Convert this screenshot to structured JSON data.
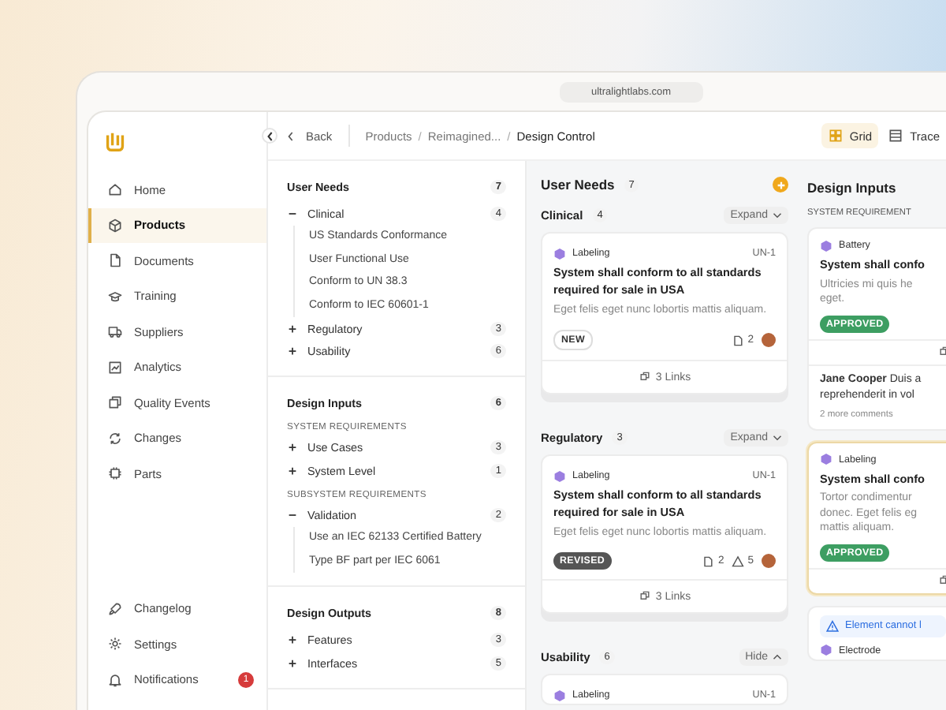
{
  "browser": {
    "url": "ultralightlabs.com"
  },
  "sidebar": {
    "items": [
      {
        "label": "Home",
        "selected": false
      },
      {
        "label": "Products",
        "selected": true
      },
      {
        "label": "Documents",
        "selected": false
      },
      {
        "label": "Training",
        "selected": false
      },
      {
        "label": "Suppliers",
        "selected": false
      },
      {
        "label": "Analytics",
        "selected": false
      },
      {
        "label": "Quality Events",
        "selected": false
      },
      {
        "label": "Changes",
        "selected": false
      },
      {
        "label": "Parts",
        "selected": false
      }
    ],
    "footer_items": [
      {
        "label": "Changelog"
      },
      {
        "label": "Settings"
      },
      {
        "label": "Notifications",
        "badge": "1"
      }
    ]
  },
  "toolbar": {
    "back": "Back",
    "breadcrumb": [
      "Products",
      "Reimagined...",
      "Design Control"
    ],
    "separators": [
      "/",
      "/"
    ],
    "views": [
      {
        "label": "Grid",
        "selected": true
      },
      {
        "label": "Trace",
        "selected": false
      }
    ]
  },
  "tree": {
    "sections": [
      {
        "title": "User Needs",
        "count": "7",
        "groups": [
          {
            "nodes": [
              {
                "label": "Clinical",
                "count": "4",
                "expanded": true,
                "children": [
                  {
                    "label": "US Standards Conformance"
                  },
                  {
                    "label": "User Functional Use"
                  },
                  {
                    "label": "Conform to UN 38.3"
                  },
                  {
                    "label": "Conform to IEC 60601-1"
                  }
                ]
              },
              {
                "label": "Regulatory",
                "count": "3",
                "expanded": false
              },
              {
                "label": "Usability",
                "count": "6",
                "expanded": false
              }
            ]
          }
        ]
      },
      {
        "title": "Design Inputs",
        "count": "6",
        "groups": [
          {
            "heading": "SYSTEM REQUIREMENTS",
            "nodes": [
              {
                "label": "Use Cases",
                "count": "3",
                "expanded": false
              },
              {
                "label": "System Level",
                "count": "1",
                "expanded": false
              }
            ]
          },
          {
            "heading": "SUBSYSTEM REQUIREMENTS",
            "nodes": [
              {
                "label": "Validation",
                "count": "2",
                "expanded": true,
                "children": [
                  {
                    "label": "Use an IEC 62133 Certified Battery"
                  },
                  {
                    "label": "Type BF part per IEC 6061"
                  }
                ]
              }
            ]
          }
        ]
      },
      {
        "title": "Design Outputs",
        "count": "8",
        "groups": [
          {
            "nodes": [
              {
                "label": "Features",
                "count": "3",
                "expanded": false
              },
              {
                "label": "Interfaces",
                "count": "5",
                "expanded": false
              }
            ]
          }
        ]
      }
    ]
  },
  "board": {
    "columns": [
      {
        "title": "User Needs",
        "count": "7",
        "add": true,
        "groups": [
          {
            "title": "Clinical",
            "count": "4",
            "toggle": "Expand",
            "expanded": false,
            "cards": [
              {
                "category": "Labeling",
                "id": "UN-1",
                "title": "System shall conform to all standards required for sale in USA",
                "description": [
                  "Eget felis eget nunc lobortis mattis aliquam."
                ],
                "status": {
                  "label": "NEW",
                  "kind": "outline"
                },
                "comments": "2",
                "avatar": true,
                "links": "3 Links",
                "selected": false
              }
            ]
          },
          {
            "title": "Regulatory",
            "count": "3",
            "toggle": "Expand",
            "expanded": false,
            "cards": [
              {
                "category": "Labeling",
                "id": "UN-1",
                "title": "System shall conform to all standards required for sale in USA",
                "description": [
                  "Eget felis eget nunc lobortis mattis aliquam."
                ],
                "status": {
                  "label": "REVISED",
                  "kind": "dark"
                },
                "comments": "2",
                "warnings": "5",
                "avatar": true,
                "links": "3 Links",
                "selected": false
              }
            ]
          },
          {
            "title": "Usability",
            "count": "6",
            "toggle": "Hide",
            "expanded": true,
            "cards": [
              {
                "category": "Labeling",
                "id": "UN-1",
                "selected": false
              }
            ]
          }
        ]
      },
      {
        "title": "Design Inputs",
        "groups": [
          {
            "heading": "SYSTEM REQUIREMENT",
            "cards": [
              {
                "category": "Battery",
                "title": "System shall confo",
                "description": [
                  "Ultricies mi quis he",
                  "eget."
                ],
                "status": {
                  "label": "APPROVED",
                  "kind": "green"
                },
                "has_links": true,
                "comment": {
                  "lines": [
                    "**Jane Cooper** Duis a",
                    "reprehenderit in vol"
                  ],
                  "more": "2 more comments"
                },
                "selected": false
              },
              {
                "category": "Labeling",
                "title": "System shall confo",
                "description": [
                  "Tortor condimentur",
                  "donec. Eget felis eg",
                  "mattis aliquam."
                ],
                "status": {
                  "label": "APPROVED",
                  "kind": "green"
                },
                "has_links": true,
                "selected": true
              },
              {
                "warning": "Element cannot l",
                "category": "Electrode",
                "selected": false
              }
            ]
          }
        ]
      }
    ]
  }
}
